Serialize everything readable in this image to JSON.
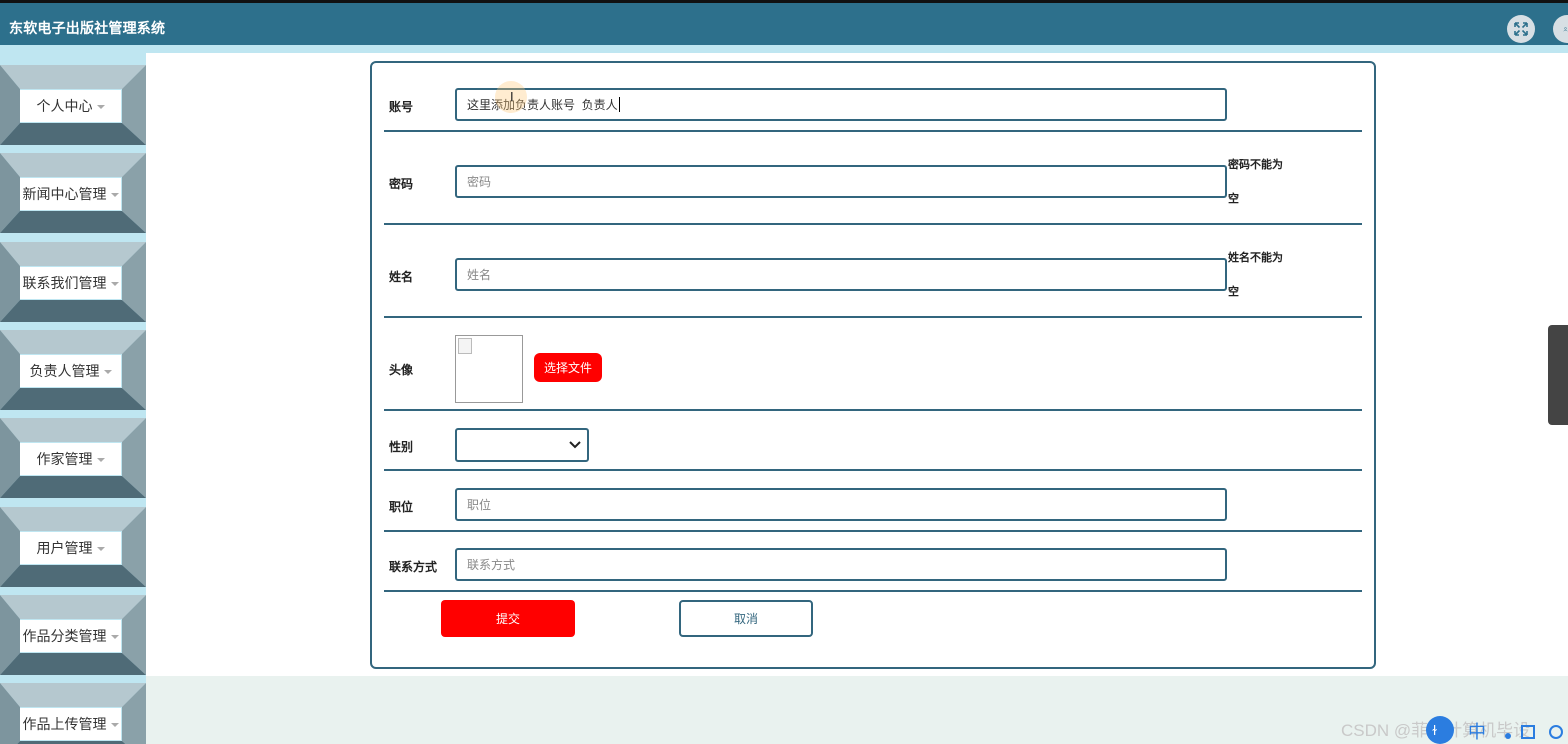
{
  "app": {
    "title": "东软电子出版社管理系统"
  },
  "header": {
    "fullscreen_icon": "expand-icon",
    "user_icon": "user-icon"
  },
  "sidebar": {
    "items": [
      {
        "label": "个人中心"
      },
      {
        "label": "新闻中心管理"
      },
      {
        "label": "联系我们管理"
      },
      {
        "label": "负责人管理"
      },
      {
        "label": "作家管理"
      },
      {
        "label": "用户管理"
      },
      {
        "label": "作品分类管理"
      },
      {
        "label": "作品上传管理"
      }
    ]
  },
  "form": {
    "account": {
      "label": "账号",
      "value": "这里添加负责人账号  负责人"
    },
    "password": {
      "label": "密码",
      "placeholder": "密码",
      "error_line1": "密码不能为",
      "error_line2": "空"
    },
    "name": {
      "label": "姓名",
      "placeholder": "姓名",
      "error_line1": "姓名不能为",
      "error_line2": "空"
    },
    "avatar": {
      "label": "头像",
      "button": "选择文件"
    },
    "gender": {
      "label": "性别",
      "value": ""
    },
    "position": {
      "label": "职位",
      "placeholder": "职位"
    },
    "contact": {
      "label": "联系方式",
      "placeholder": "联系方式"
    },
    "submit": "提交",
    "cancel": "取消"
  },
  "watermark": "CSDN @菲菲计算机毕设",
  "colors": {
    "header": "#2d708c",
    "accent_border": "#33667e",
    "danger_button": "#ff0000",
    "sidebar_bg": "#bfe6f1"
  }
}
